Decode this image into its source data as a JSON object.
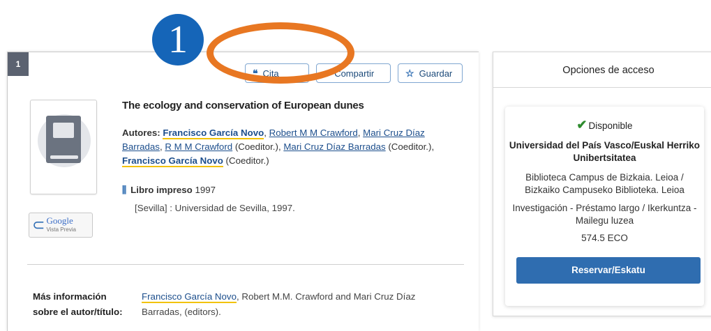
{
  "annotation": {
    "step_number": "1",
    "accent_color": "#e87722",
    "badge_color": "#1565b8"
  },
  "result": {
    "number": "1",
    "actions": {
      "cite_label": "Cita",
      "share_label": "Compartir",
      "save_label": "Guardar"
    },
    "title": "The ecology and conservation of European dunes",
    "authors_label": "Autores:",
    "authors": [
      {
        "name": "Francisco García Novo",
        "highlighted": true,
        "sep": ", "
      },
      {
        "name": "Robert M M Crawford",
        "highlighted": false,
        "sep": ","
      },
      {
        "name": "Mari Cruz Díaz Barradas",
        "highlighted": false,
        "sep": ", "
      },
      {
        "name": "R M M Crawford",
        "highlighted": false,
        "role": "(Coeditor.)",
        "sep": ","
      },
      {
        "name": "Mari Cruz Díaz Barradas",
        "highlighted": false,
        "role": "(Coeditor.)",
        "sep": ", "
      },
      {
        "name": "Francisco García Novo",
        "highlighted": true,
        "role": "(Coeditor.)",
        "sep": ""
      }
    ],
    "format": {
      "label": "Libro impreso",
      "year": "1997"
    },
    "publisher": "[Sevilla] : Universidad de Sevilla, 1997.",
    "google_preview": {
      "brand": "Google",
      "label": "Vista Previa"
    },
    "more_info": {
      "label_line1": "Más información",
      "label_line2": "sobre el autor/título:",
      "author_link": "Francisco García Novo",
      "rest_line1": ", Robert M.M. Crawford and Mari Cruz Díaz",
      "rest_line2": "Barradas, (editors)."
    }
  },
  "access": {
    "header": "Opciones de acceso",
    "availability": "Disponible",
    "institution": "Universidad del País Vasco/Euskal Herriko Unibertsitatea",
    "location_line1": "Biblioteca Campus de Bizkaia. Leioa /",
    "location_line2": "Bizkaiko Campuseko Biblioteka. Leioa",
    "loan_line1": "Investigación - Préstamo largo / Ikerkuntza -",
    "loan_line2": "Mailegu luzea",
    "call_number": "574.5 ECO",
    "reserve_label": "Reservar/Eskatu"
  }
}
